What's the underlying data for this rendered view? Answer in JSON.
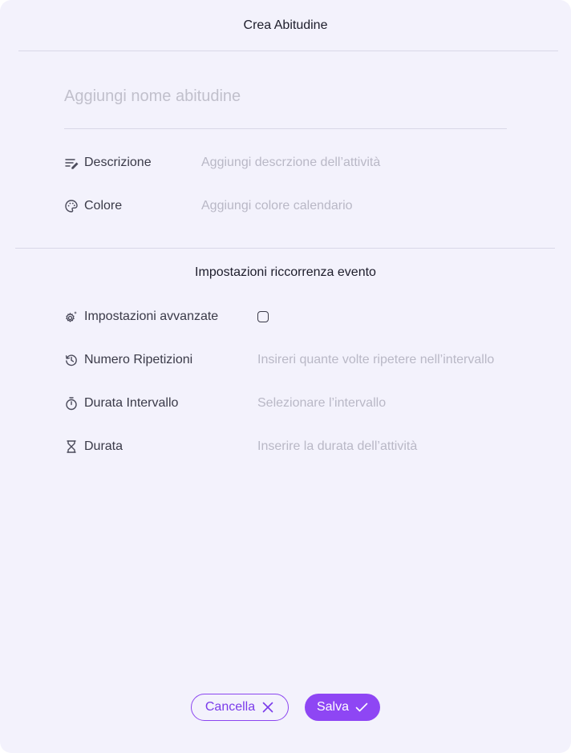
{
  "header": {
    "title": "Crea Abitudine"
  },
  "name_field": {
    "placeholder": "Aggiungi nome abitudine"
  },
  "details": {
    "description": {
      "label": "Descrizione",
      "placeholder": "Aggiungi descrzione dell’attività",
      "icon": "edit-lines-icon"
    },
    "color": {
      "label": "Colore",
      "placeholder": "Aggiungi colore calendario",
      "icon": "palette-icon"
    }
  },
  "recurrence": {
    "title": "Impostazioni riccorrenza evento",
    "advanced": {
      "label": "Impostazioni avvanzate",
      "checked": false,
      "icon": "gear-sparkle-icon"
    },
    "repetitions": {
      "label": "Numero Ripetizioni",
      "placeholder": "Insireri quante volte ripetere nell’intervallo",
      "icon": "history-icon"
    },
    "interval": {
      "label": "Durata Intervallo",
      "placeholder": "Selezionare l’intervallo",
      "icon": "timer-icon"
    },
    "duration": {
      "label": "Durata",
      "placeholder": "Inserire la durata dell’attività",
      "icon": "hourglass-icon"
    }
  },
  "footer": {
    "cancel_label": "Cancella",
    "save_label": "Salva",
    "accent": "#8e46f4",
    "background": "#f3f2fc"
  }
}
